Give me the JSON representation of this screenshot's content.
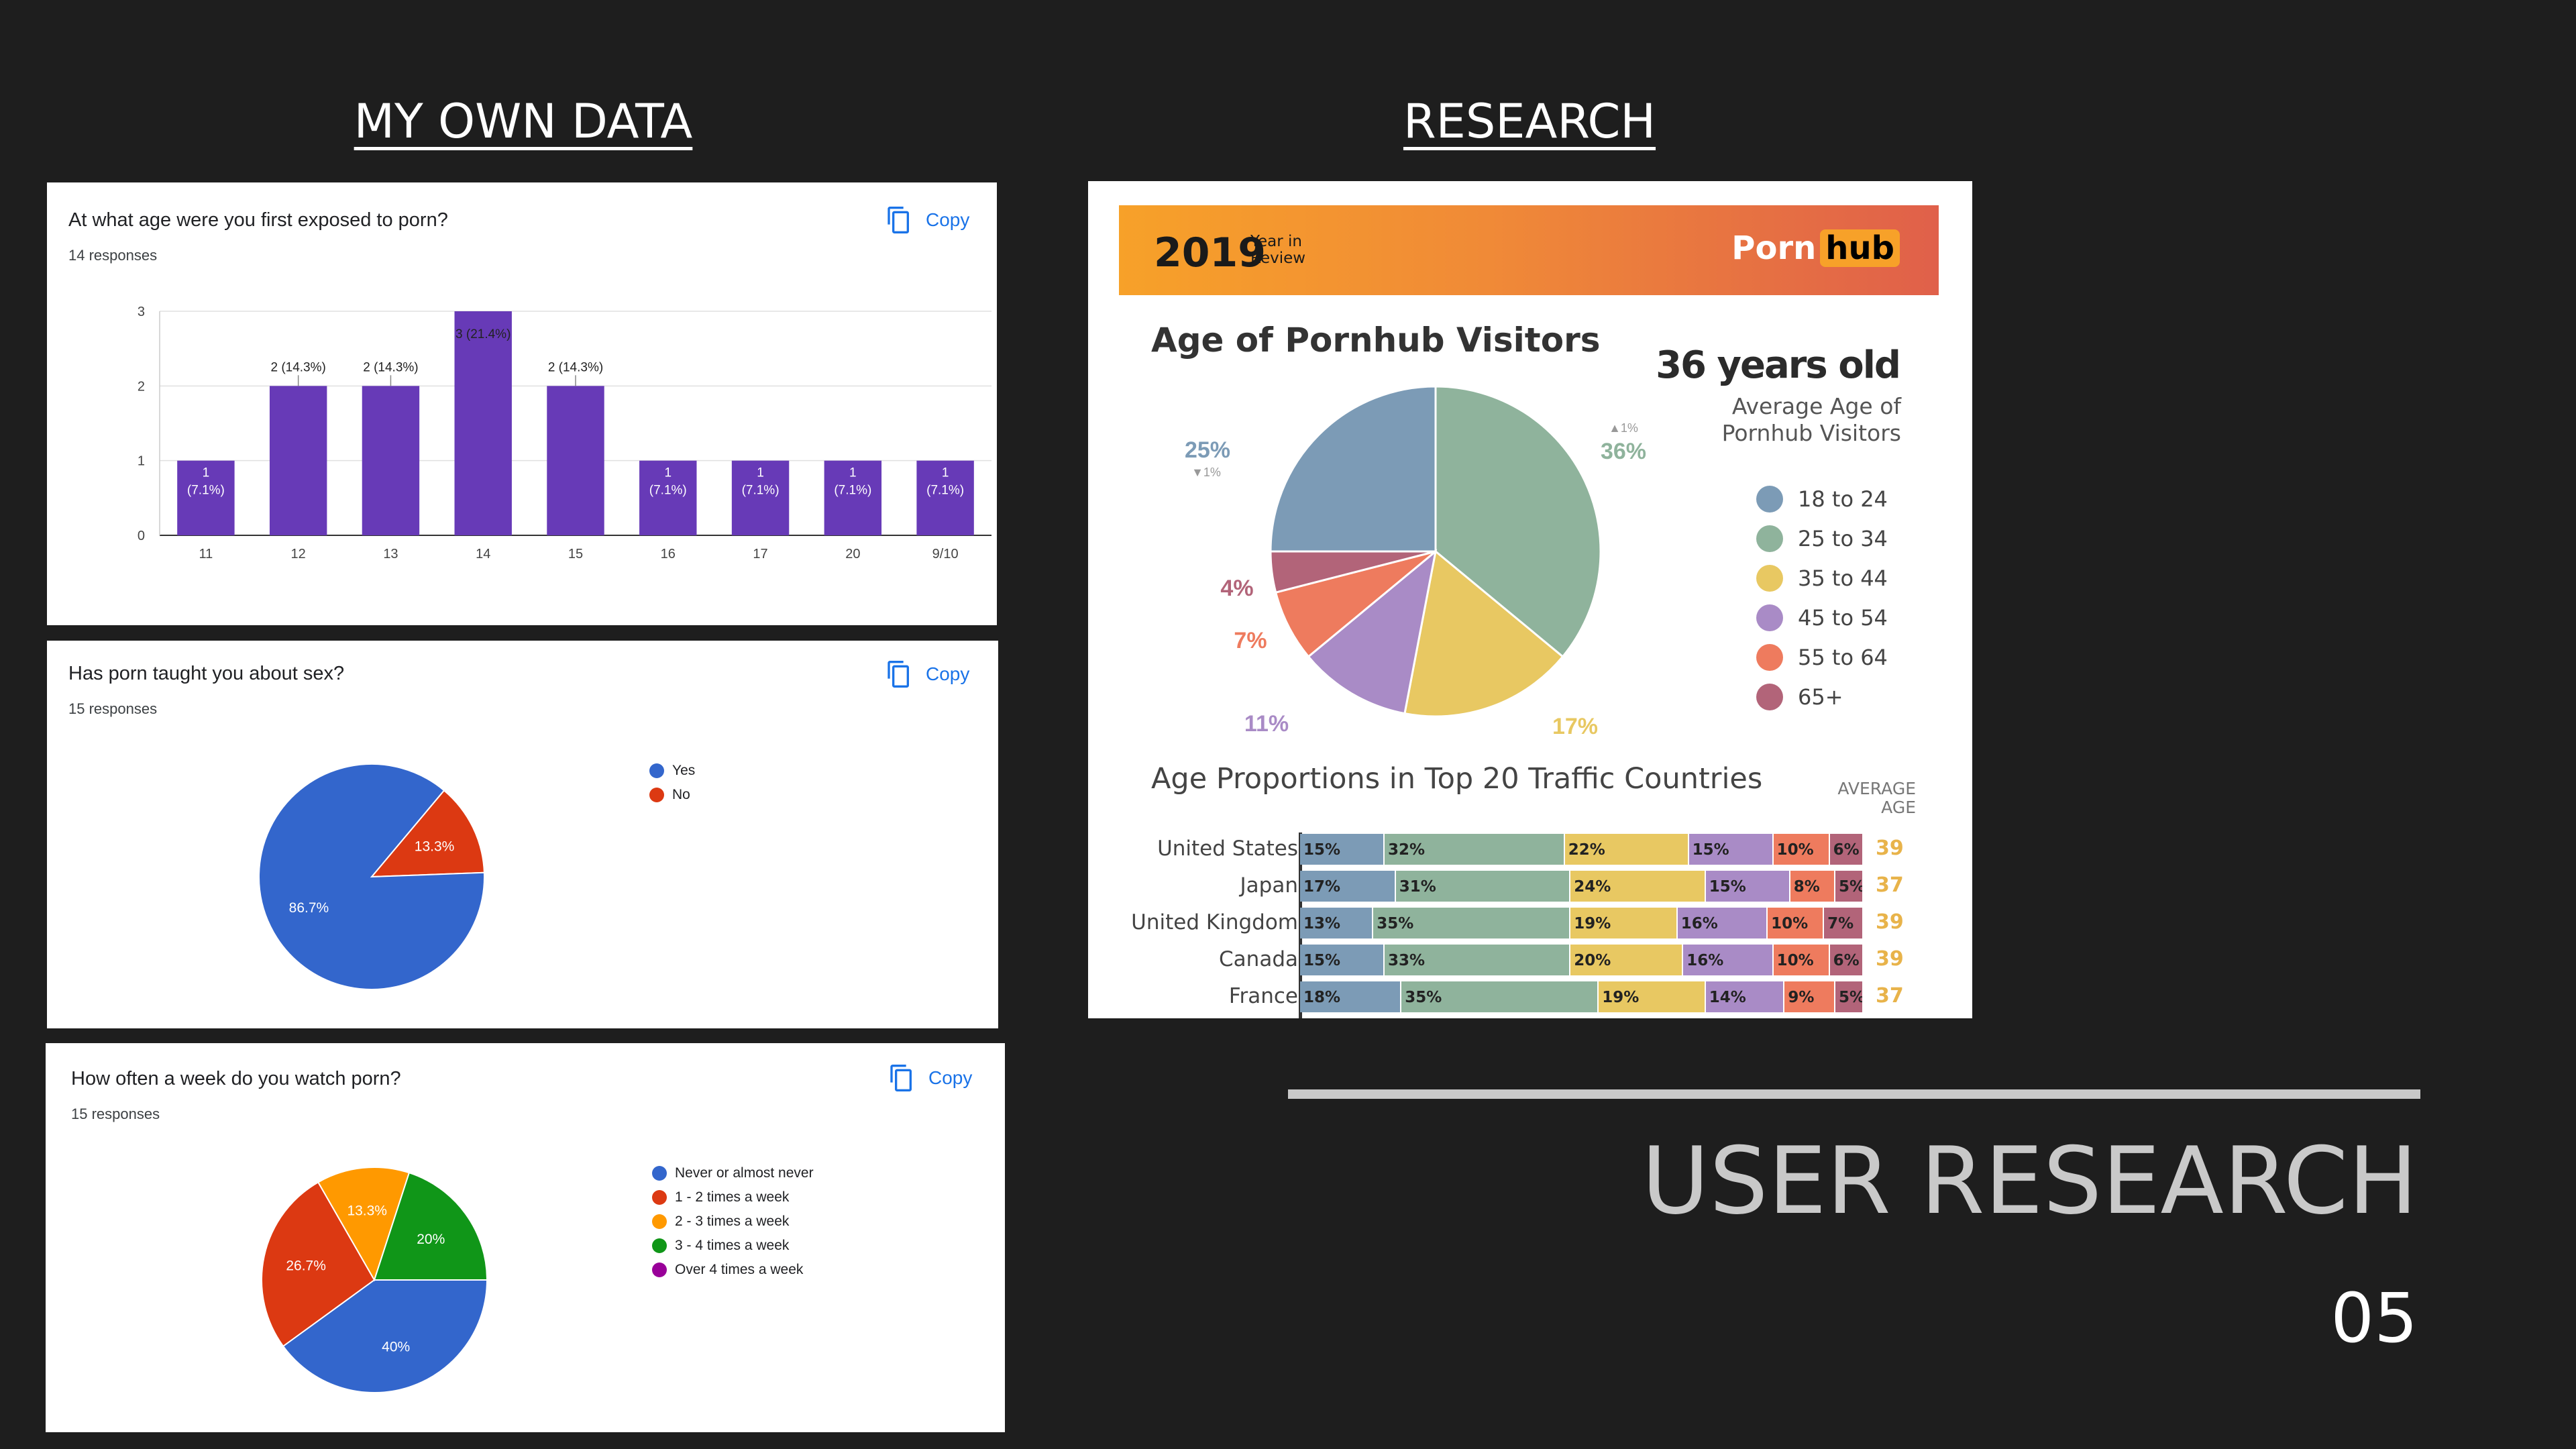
{
  "headings": {
    "left": "MY OWN DATA",
    "right": "RESEARCH"
  },
  "footer": {
    "title": "USER RESEARCH",
    "page_number": "05"
  },
  "colors": {
    "background": "#1e1e1e",
    "forms_purple": "#673ab7",
    "forms_blue": "#3366cc",
    "forms_red": "#dc3912",
    "forms_orange": "#ff9900",
    "forms_green": "#109618",
    "forms_violet": "#990099"
  },
  "card1": {
    "question": "At what age were you first exposed to porn?",
    "responses": "14 responses",
    "copy": "Copy"
  },
  "card2": {
    "question": "Has porn taught you about sex?",
    "responses": "15 responses",
    "copy": "Copy"
  },
  "card3": {
    "question": "How often a week do you watch porn?",
    "responses": "15 responses",
    "copy": "Copy"
  },
  "pornhub": {
    "year": "2019",
    "year_in_review": [
      "Year in",
      "Review"
    ],
    "logo_left": "Porn",
    "logo_right": "hub",
    "title": "Age of Pornhub Visitors",
    "average": "36 years old",
    "average_label": [
      "Average Age of",
      "Pornhub Visitors"
    ],
    "subtitle": "Age Proportions in Top 20 Traffic Countries",
    "average_age_label": [
      "AVERAGE",
      "AGE"
    ],
    "annotations": {
      "up": "▲1%",
      "down": "▼1%"
    }
  },
  "chart_data": [
    {
      "type": "bar",
      "title": "At what age were you first exposed to porn?",
      "categories": [
        "11",
        "12",
        "13",
        "14",
        "15",
        "16",
        "17",
        "20",
        "9/10"
      ],
      "values": [
        1,
        2,
        2,
        3,
        2,
        1,
        1,
        1,
        1
      ],
      "data_labels": [
        "1\n(7.1%)",
        "2 (14.3%)",
        "2 (14.3%)",
        "3 (21.4%)",
        "2 (14.3%)",
        "1\n(7.1%)",
        "1\n(7.1%)",
        "1\n(7.1%)",
        "1\n(7.1%)"
      ],
      "yticks": [
        "0",
        "1",
        "2",
        "3"
      ],
      "ylim": [
        0,
        3
      ],
      "color": "#673ab7",
      "grid": true
    },
    {
      "type": "pie",
      "title": "Has porn taught you about sex?",
      "categories": [
        "Yes",
        "No"
      ],
      "values": [
        86.7,
        13.3
      ],
      "data_labels": [
        "86.7%",
        "13.3%"
      ],
      "colors": [
        "#3366cc",
        "#dc3912"
      ],
      "legend": "right"
    },
    {
      "type": "pie",
      "title": "How often a week do you watch porn?",
      "categories": [
        "Never or almost never",
        "1 - 2 times a week",
        "2 - 3 times a week",
        "3 - 4 times a week",
        "Over 4 times a week"
      ],
      "values": [
        40,
        26.7,
        13.3,
        20,
        0
      ],
      "data_labels": [
        "40%",
        "26.7%",
        "13.3%",
        "20%",
        ""
      ],
      "colors": [
        "#3366cc",
        "#dc3912",
        "#ff9900",
        "#109618",
        "#990099"
      ],
      "legend": "right"
    },
    {
      "type": "pie",
      "title": "Age of Pornhub Visitors",
      "categories": [
        "18 to 24",
        "25 to 34",
        "35 to 44",
        "45 to 54",
        "55 to 64",
        "65+"
      ],
      "values": [
        25,
        36,
        17,
        11,
        7,
        4
      ],
      "data_labels": [
        "25%",
        "36%",
        "17%",
        "11%",
        "7%",
        "4%"
      ],
      "colors": [
        "#7c9bb6",
        "#8fb39c",
        "#e8c862",
        "#a98bc6",
        "#ee7b5e",
        "#b26479"
      ],
      "legend": "right"
    },
    {
      "type": "bar",
      "title": "Age Proportions in Top 20 Traffic Countries",
      "orientation": "horizontal-stacked",
      "categories": [
        "United States",
        "Japan",
        "United Kingdom",
        "Canada",
        "France"
      ],
      "series_colors": [
        "#7c9bb6",
        "#8fb39c",
        "#e8c862",
        "#a98bc6",
        "#ee7b5e",
        "#b26479"
      ],
      "series": [
        {
          "values": [
            15,
            17,
            13,
            15,
            18
          ]
        },
        {
          "values": [
            32,
            31,
            35,
            33,
            35
          ]
        },
        {
          "values": [
            22,
            24,
            19,
            20,
            19
          ]
        },
        {
          "values": [
            15,
            15,
            16,
            16,
            14
          ]
        },
        {
          "values": [
            10,
            8,
            10,
            10,
            9
          ]
        },
        {
          "values": [
            6,
            5,
            7,
            6,
            5
          ]
        }
      ],
      "average_age": [
        "39",
        "37",
        "39",
        "39",
        "37"
      ]
    }
  ]
}
